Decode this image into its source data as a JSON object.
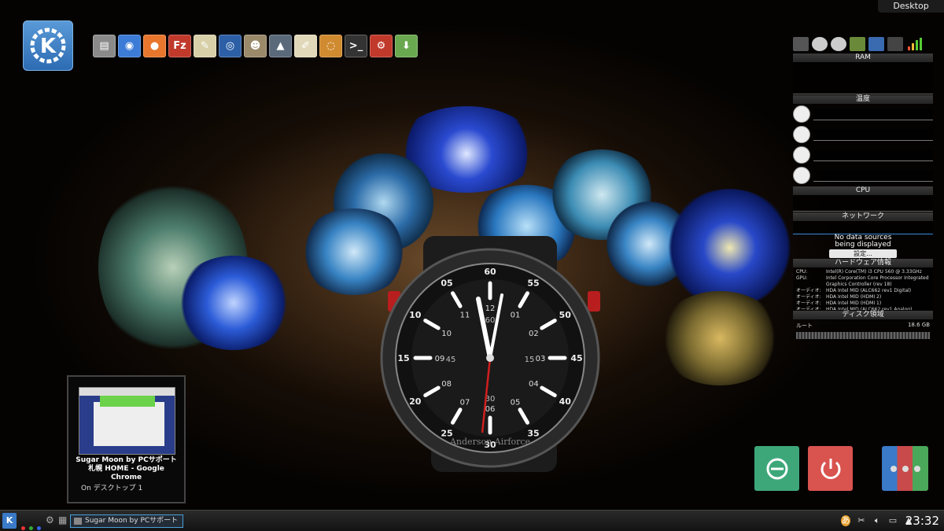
{
  "desktop": {
    "label": "Desktop"
  },
  "launcher": {
    "icon": "kde-logo-icon"
  },
  "quicklaunch": [
    {
      "name": "file-manager-icon",
      "glyph": "▤",
      "color": "#8a8a8a"
    },
    {
      "name": "chrome-icon",
      "glyph": "◉",
      "color": "#3c7bd6"
    },
    {
      "name": "firefox-icon",
      "glyph": "●",
      "color": "#e8762c"
    },
    {
      "name": "filezilla-icon",
      "glyph": "Fz",
      "color": "#c0392b"
    },
    {
      "name": "text-editor-icon",
      "glyph": "✎",
      "color": "#d8d0a8"
    },
    {
      "name": "settings-circle-icon",
      "glyph": "◎",
      "color": "#2d5fa6"
    },
    {
      "name": "gimp-icon",
      "glyph": "☻",
      "color": "#9a8a6a"
    },
    {
      "name": "inkscape-icon",
      "glyph": "▲",
      "color": "#5a6a7a"
    },
    {
      "name": "notes-icon",
      "glyph": "✐",
      "color": "#e0d8b8"
    },
    {
      "name": "disc-icon",
      "glyph": "◌",
      "color": "#d08a30"
    },
    {
      "name": "terminal-icon",
      "glyph": ">_",
      "color": "#333"
    },
    {
      "name": "system-settings-icon",
      "glyph": "⚙",
      "color": "#c0392b"
    },
    {
      "name": "download-icon",
      "glyph": "⬇",
      "color": "#6aa84f"
    }
  ],
  "sysmon": {
    "ram_label": "RAM",
    "temp_label": "温度",
    "cpu_label": "CPU",
    "network_label": "ネットワーク",
    "no_data": "No data sources",
    "no_data2": "being displayed",
    "settings_button": "設定...",
    "hw_label": "ハードウェア情報",
    "hw_lines": [
      {
        "k": "CPU:",
        "v": "Intel(R) Core(TM) i3 CPU 560 @ 3.33GHz"
      },
      {
        "k": "GPU:",
        "v": "Intel Corporation Core Processor Integrated"
      },
      {
        "k": "",
        "v": "Graphics Controller (rev 18)"
      },
      {
        "k": "オーディオ:",
        "v": "HDA Intel MID (ALC662 rev1 Digital)"
      },
      {
        "k": "オーディオ:",
        "v": "HDA Intel MID (HDMI 2)"
      },
      {
        "k": "オーディオ:",
        "v": "HDA Intel MID (HDMI 1)"
      },
      {
        "k": "オーディオ:",
        "v": "HDA Intel MID (ALC662 rev1 Analog)"
      }
    ],
    "disk_label": "ディスク領域",
    "disk_name": "ルート",
    "disk_size": "18.6 GB"
  },
  "tooltip": {
    "title": "Sugar Moon by PCサポート札幌 HOME - Google Chrome",
    "subtitle": "On デスクトップ 1"
  },
  "watch": {
    "bezel_numbers": [
      "60",
      "55",
      "50",
      "45",
      "40",
      "35",
      "30",
      "25",
      "20",
      "15",
      "10",
      "05"
    ],
    "hour_numbers": [
      "12",
      "01",
      "02",
      "03",
      "04",
      "05",
      "06",
      "07",
      "08",
      "09",
      "10",
      "11"
    ],
    "inner_numbers": {
      "n60": "60",
      "n30": "30",
      "n45": "45",
      "n15": "15"
    },
    "brand": "Anderson Airforce"
  },
  "buttons": {
    "refresh_color": "#3ea77a",
    "power_color": "#d9534f"
  },
  "taskbar": {
    "task_label": "Sugar Moon by PCサポート",
    "clock": "23:32"
  }
}
